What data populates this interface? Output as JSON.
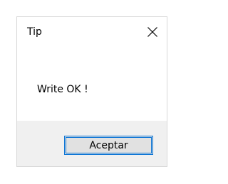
{
  "dialog": {
    "title": "Tip",
    "close_icon": "close-icon",
    "message": "Write OK !",
    "button_label": "Aceptar"
  },
  "colors": {
    "footer_bg": "#f0f0f0",
    "button_border": "#0a74d6",
    "button_bg": "#e1e1e1"
  }
}
